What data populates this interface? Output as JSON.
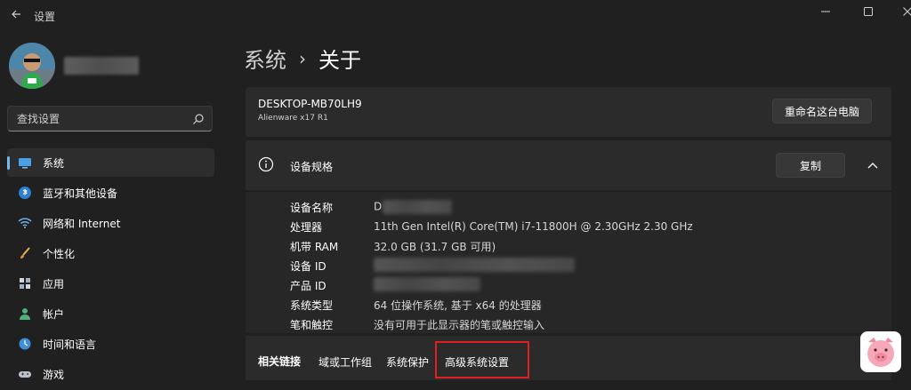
{
  "window": {
    "title": "设置",
    "back_icon": "back-arrow-icon",
    "controls": [
      "minimize-icon",
      "maximize-icon",
      "close-icon"
    ]
  },
  "sidebar": {
    "search": {
      "placeholder": "查找设置",
      "icon": "search-icon"
    },
    "items": [
      {
        "label": "系统",
        "icon": "monitor-icon",
        "active": true
      },
      {
        "label": "蓝牙和其他设备",
        "icon": "bluetooth-icon"
      },
      {
        "label": "网络和 Internet",
        "icon": "wifi-icon"
      },
      {
        "label": "个性化",
        "icon": "brush-icon"
      },
      {
        "label": "应用",
        "icon": "apps-icon"
      },
      {
        "label": "帐户",
        "icon": "person-icon"
      },
      {
        "label": "时间和语言",
        "icon": "globe-clock-icon"
      },
      {
        "label": "游戏",
        "icon": "gamepad-icon"
      }
    ]
  },
  "breadcrumb": {
    "parent": "系统",
    "separator": "›",
    "current": "关于"
  },
  "pc": {
    "name": "DESKTOP-MB70LH9",
    "model": "Alienware x17 R1",
    "rename_button": "重命名这台电脑"
  },
  "specs": {
    "title": "设备规格",
    "copy_button": "复制",
    "rows": [
      {
        "label": "设备名称",
        "value": "D"
      },
      {
        "label": "处理器",
        "value": "11th Gen Intel(R) Core(TM) i7-11800H @ 2.30GHz   2.30 GHz"
      },
      {
        "label": "机带 RAM",
        "value": "32.0 GB (31.7 GB 可用)"
      },
      {
        "label": "设备 ID",
        "value": ""
      },
      {
        "label": "产品 ID",
        "value": ""
      },
      {
        "label": "系统类型",
        "value": "64 位操作系统, 基于 x64 的处理器"
      },
      {
        "label": "笔和触控",
        "value": "没有可用于此显示器的笔或触控输入"
      }
    ]
  },
  "related": {
    "title": "相关链接",
    "links": [
      "域或工作组",
      "系统保护",
      "高级系统设置"
    ]
  },
  "colors": {
    "background": "#202020",
    "card": "#2b2b2b",
    "accent": "#76b9ed",
    "highlight": "#e02020"
  }
}
